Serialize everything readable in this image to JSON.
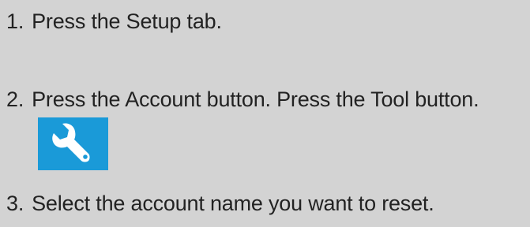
{
  "steps": [
    {
      "number": "1.",
      "text": "Press the Setup tab."
    },
    {
      "number": "2.",
      "text": "Press the Account button. Press the Tool button."
    },
    {
      "number": "3.",
      "text": "Select the account name you want to reset."
    }
  ],
  "tool_icon": {
    "name": "wrench-icon",
    "background": "#1a9ad8",
    "foreground": "#ffffff"
  }
}
